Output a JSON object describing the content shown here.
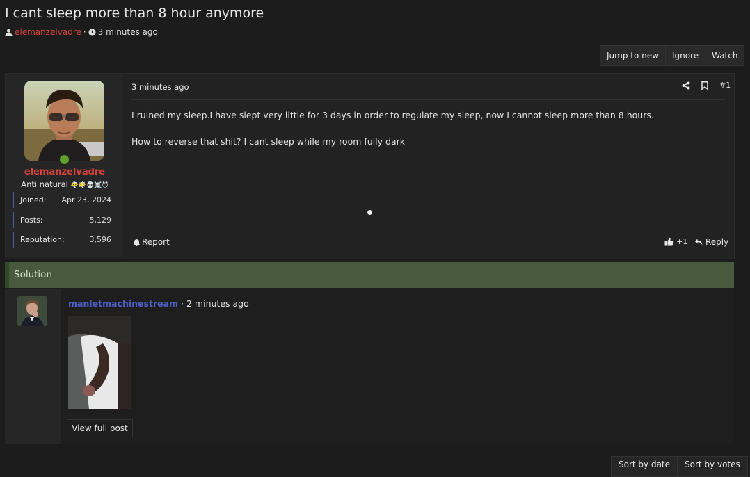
{
  "thread": {
    "title": "I cant sleep more than 8 hour anymore",
    "author": "elemanzelvadre",
    "separator": "·",
    "time": "3 minutes ago"
  },
  "toolbar": {
    "jump": "Jump to new",
    "ignore": "Ignore",
    "watch": "Watch"
  },
  "post": {
    "time": "3 minutes ago",
    "number": "#1",
    "paragraphs": [
      "I ruined my sleep.I have slept very little for 3 days in order to regulate my sleep, now I cannot sleep more than 8 hours.",
      "How to reverse that shit? I cant sleep while my room fully dark"
    ],
    "report": "Report",
    "likes": "+1",
    "reply": "Reply"
  },
  "user": {
    "name": "elemanzelvadre",
    "title": "Anti natural",
    "title_emojis": "😶‍🌫️😶‍🌫️💀☠️😈",
    "stats": [
      {
        "label": "Joined:",
        "value": "Apr 23, 2024"
      },
      {
        "label": "Posts:",
        "value": "5,129"
      },
      {
        "label": "Reputation:",
        "value": "3,596"
      }
    ]
  },
  "solution": {
    "header": "Solution",
    "user": "manletmachinestream",
    "separator": "·",
    "time": "2 minutes ago",
    "view_full": "View full post"
  },
  "sort": {
    "by_date": "Sort by date",
    "by_votes": "Sort by votes"
  },
  "colors": {
    "accent_user": "#d9433a",
    "solution_bg": "#475a3d",
    "online": "#5ea02b",
    "link_user": "#4e5ec8"
  }
}
